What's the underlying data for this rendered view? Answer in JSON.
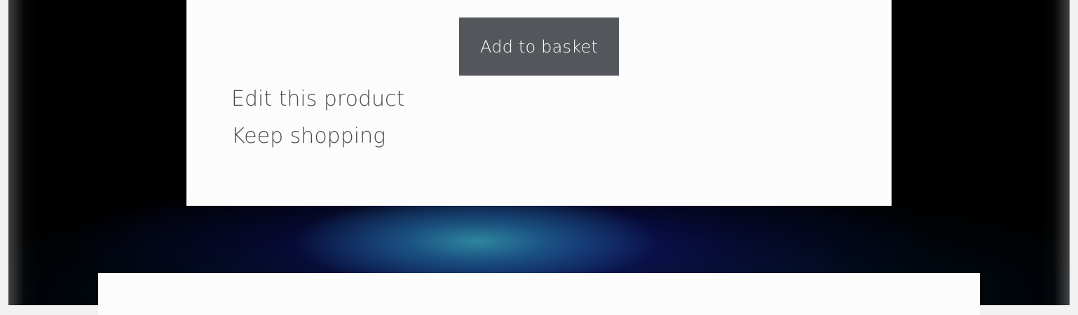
{
  "product_actions": {
    "add_to_basket_label": "Add to basket",
    "links": [
      {
        "label": "Edit this product"
      },
      {
        "label": "Keep shopping"
      }
    ]
  },
  "colors": {
    "button_background": "#53565a",
    "button_text": "#ffffff",
    "card_background": "#fcfcfc",
    "link_text": "#4a4a4a",
    "page_background": "#000000",
    "glow_accent": "#2a8aa0"
  }
}
